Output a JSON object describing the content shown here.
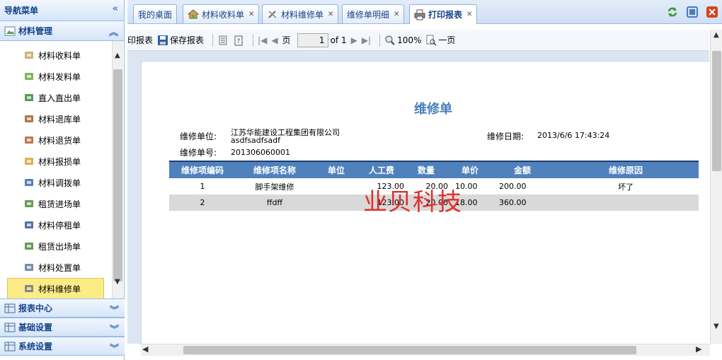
{
  "sidebar": {
    "title": "导航菜单",
    "section": "材料管理",
    "items": [
      {
        "label": "材料收料单",
        "icon": "house-icon"
      },
      {
        "label": "材料发料单",
        "icon": "house-out-icon"
      },
      {
        "label": "直入直出单",
        "icon": "grid-check-icon"
      },
      {
        "label": "材料退库单",
        "icon": "truck-icon"
      },
      {
        "label": "材料退货单",
        "icon": "truck-return-icon"
      },
      {
        "label": "材料报损单",
        "icon": "edit-doc-icon"
      },
      {
        "label": "材料调拨单",
        "icon": "transfer-icon"
      },
      {
        "label": "租赁进场单",
        "icon": "lease-in-icon"
      },
      {
        "label": "材料停租单",
        "icon": "pause-icon"
      },
      {
        "label": "租赁出场单",
        "icon": "lease-out-icon"
      },
      {
        "label": "材料处置单",
        "icon": "dispose-icon"
      },
      {
        "label": "材料维修单",
        "icon": "tools-icon"
      }
    ],
    "bottom_panels": [
      {
        "label": "报表中心",
        "icon": "table-icon"
      },
      {
        "label": "基础设置",
        "icon": "settings-doc-icon"
      },
      {
        "label": "系统设置",
        "icon": "monitor-icon"
      }
    ]
  },
  "tabs": [
    {
      "label": "我的桌面",
      "closable": false
    },
    {
      "label": "材料收料单",
      "closable": true
    },
    {
      "label": "材料维修单",
      "closable": true
    },
    {
      "label": "维修单明细",
      "closable": true
    },
    {
      "label": "打印报表",
      "closable": true,
      "active": true
    }
  ],
  "toolbar": {
    "print_partial": "印报表",
    "save": "保存报表",
    "page_label": "页",
    "page_value": "1",
    "of": "of 1",
    "zoom": "100%",
    "one_page": "一页"
  },
  "report": {
    "title": "维修单",
    "unit_label": "维修单位:",
    "unit_value_1": "江苏华能建设工程集团有限公司",
    "unit_value_2": "asdfsadfsadf",
    "date_label": "维修日期:",
    "date_value": "2013/6/6 17:43:24",
    "number_label": "维修单号:",
    "number_value": "201306060001",
    "columns": [
      "维修项编码",
      "维修项名称",
      "单位",
      "人工费",
      "数量",
      "单价",
      "金额",
      "维修原因"
    ],
    "rows": [
      [
        "1",
        "脚手架维修",
        "",
        "123.00",
        "20.00",
        "10.00",
        "200.00",
        "坏了"
      ],
      [
        "2",
        "ffdff",
        "",
        "123.00",
        "20.00",
        "18.00",
        "360.00",
        ""
      ]
    ],
    "watermark": "业贝科技"
  },
  "colors": {
    "accent": "#15428b",
    "header_blue": "#4f81bd",
    "title_blue": "#4a7ebb",
    "active_item": "#fbec88"
  }
}
